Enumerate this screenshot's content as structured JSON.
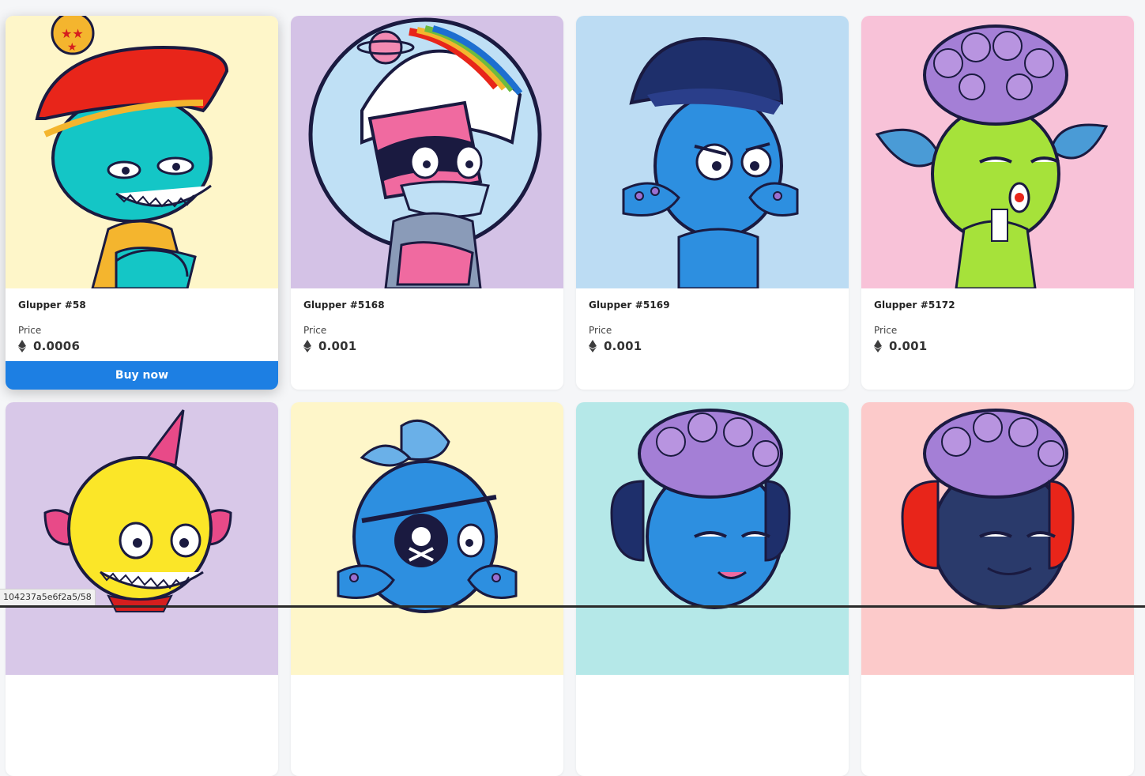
{
  "cards": [
    {
      "name": "Glupper #58",
      "price_label": "Price",
      "price": "0.0006",
      "bg": "#fef6c9",
      "buy_label": "Buy now"
    },
    {
      "name": "Glupper #5168",
      "price_label": "Price",
      "price": "0.001",
      "bg": "#d4c2e6"
    },
    {
      "name": "Glupper #5169",
      "price_label": "Price",
      "price": "0.001",
      "bg": "#bcdcf3"
    },
    {
      "name": "Glupper #5172",
      "price_label": "Price",
      "price": "0.001",
      "bg": "#f8c2d8"
    },
    {
      "bg": "#d8c8e8"
    },
    {
      "bg": "#fef6c9"
    },
    {
      "bg": "#b5e8e8"
    },
    {
      "bg": "#fccaca"
    }
  ],
  "status_bar": {
    "url": "104237a5e6f2a5/58"
  },
  "icons": {
    "currency": "ethereum-icon"
  }
}
